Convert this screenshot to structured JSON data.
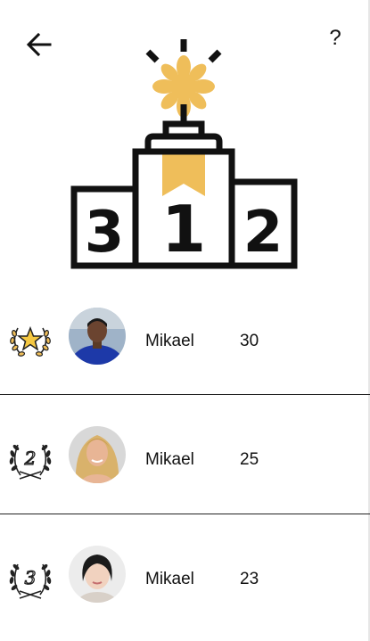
{
  "header": {
    "back_icon": "arrow-left-icon",
    "help_label": "?"
  },
  "podium": {
    "icon": "podium-trophy-icon",
    "places": [
      "3",
      "1",
      "2"
    ],
    "accent_color": "#efbe5a",
    "line_color": "#111111"
  },
  "leaderboard": [
    {
      "rank": 1,
      "badge_icon": "laurel-star-medal-icon",
      "name": "Mikael",
      "score": "30"
    },
    {
      "rank": 2,
      "badge_icon": "laurel-rank-2-icon",
      "badge_text": "2",
      "name": "Mikael",
      "score": "25"
    },
    {
      "rank": 3,
      "badge_icon": "laurel-rank-3-icon",
      "badge_text": "3",
      "name": "Mikael",
      "score": "23"
    }
  ]
}
